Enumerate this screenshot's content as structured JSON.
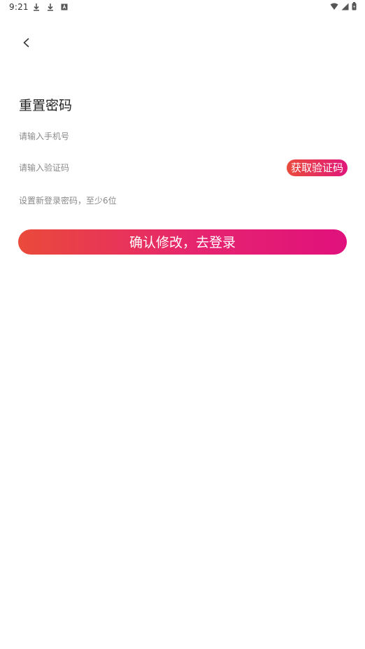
{
  "status_bar": {
    "time": "9:21",
    "icons": [
      "download-icon",
      "download-icon",
      "a-icon",
      "wifi-icon",
      "signal-icon",
      "battery-icon"
    ]
  },
  "header": {
    "back_icon": "chevron-left-icon"
  },
  "page": {
    "title": "重置密码"
  },
  "form": {
    "phone_placeholder": "请输入手机号",
    "code_placeholder": "请输入验证码",
    "get_code_label": "获取验证码",
    "password_placeholder": "设置新登录密码，至少6位",
    "submit_label": "确认修改，去登录"
  },
  "colors": {
    "accent_start": "#ea4a3a",
    "accent_end": "#e0117c"
  }
}
